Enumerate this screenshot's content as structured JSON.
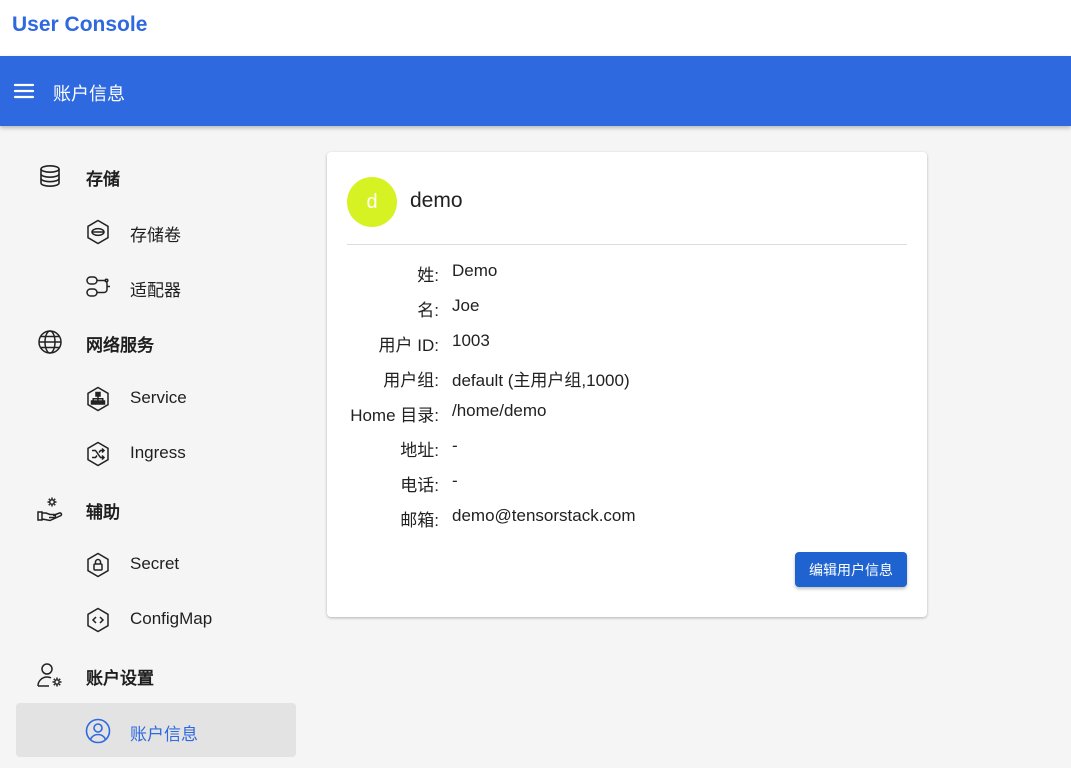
{
  "app": {
    "title": "User Console"
  },
  "appbar": {
    "title": "账户信息"
  },
  "sidebar": {
    "storage": {
      "label": "存储",
      "icon": "database-icon",
      "items": [
        {
          "label": "存储卷",
          "icon": "volume-icon"
        },
        {
          "label": "适配器",
          "icon": "adapter-icon"
        }
      ]
    },
    "network": {
      "label": "网络服务",
      "icon": "globe-icon",
      "items": [
        {
          "label": "Service",
          "icon": "service-icon"
        },
        {
          "label": "Ingress",
          "icon": "ingress-icon"
        }
      ]
    },
    "aux": {
      "label": "辅助",
      "icon": "hand-gear-icon",
      "items": [
        {
          "label": "Secret",
          "icon": "secret-icon"
        },
        {
          "label": "ConfigMap",
          "icon": "configmap-icon"
        }
      ]
    },
    "account": {
      "label": "账户设置",
      "icon": "user-gear-icon",
      "items": [
        {
          "label": "账户信息",
          "icon": "account-circle-icon",
          "active": true
        }
      ]
    }
  },
  "profile": {
    "avatar_letter": "d",
    "avatar_color": "#d6f222",
    "username": "demo",
    "fields": [
      {
        "key": "姓:",
        "value": "Demo"
      },
      {
        "key": "名:",
        "value": "Joe"
      },
      {
        "key": "用户 ID:",
        "value": "1003"
      },
      {
        "key": "用户组:",
        "value": "default (主用户组,1000)"
      },
      {
        "key": "Home 目录:",
        "value": "/home/demo"
      },
      {
        "key": "地址:",
        "value": "-"
      },
      {
        "key": "电话:",
        "value": "-"
      },
      {
        "key": "邮箱:",
        "value": "demo@tensorstack.com"
      }
    ],
    "edit_button": "编辑用户信息"
  },
  "colors": {
    "primary": "#2f69e0",
    "button": "#1e63cf",
    "active_bg": "#e3e3e3"
  }
}
